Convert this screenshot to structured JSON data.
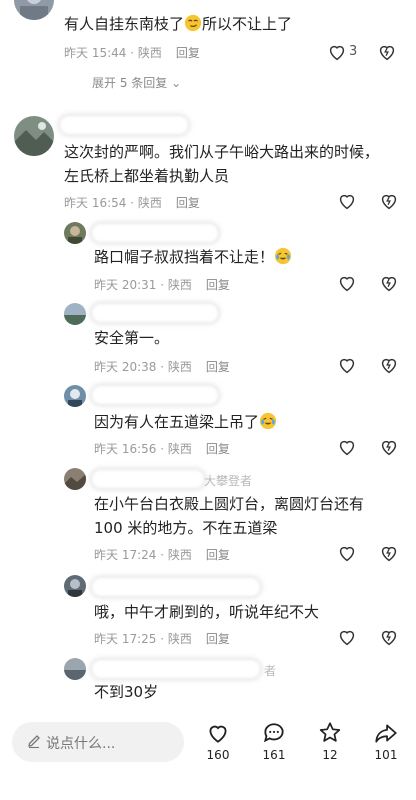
{
  "comments": [
    {
      "text_before": "有人自挂东南枝了",
      "text_after": "所以不让上了",
      "time": "昨天 15:44 · 陕西",
      "reply_label": "回复",
      "likes": "3"
    },
    {
      "expand_label": "展开 5 条回复 ⌄"
    },
    {
      "line1": "这次封的严啊。我们从子午峪大路出来的时候，",
      "line2": "左氏桥上都坐着执勤人员",
      "time": "昨天 16:54 · 陕西",
      "reply_label": "回复"
    },
    {
      "text": "路口帽子叔叔挡着不让走！",
      "time": "昨天 20:31 · 陕西",
      "reply_label": "回复"
    },
    {
      "text": "安全第一。",
      "time": "昨天 20:38 · 陕西",
      "reply_label": "回复"
    },
    {
      "text": "因为有人在五道梁上吊了",
      "time": "昨天 16:56 · 陕西",
      "reply_label": "回复"
    },
    {
      "name_partial": "大攀登者",
      "line1": "在小午台白衣殿上圆灯台，离圆灯台还有",
      "line2": "100 米的地方。不在五道梁",
      "time": "昨天 17:24 · 陕西",
      "reply_label": "回复"
    },
    {
      "text": "哦，中午才刷到的，听说年纪不大",
      "time": "昨天 17:25 · 陕西",
      "reply_label": "回复"
    },
    {
      "name_partial": "者",
      "text": "不到30岁"
    }
  ],
  "bottom_bar": {
    "input_placeholder": "说点什么...",
    "likes": "160",
    "comments": "161",
    "favorites": "12",
    "shares": "101"
  },
  "colors": {
    "text": "#222222",
    "meta": "#9a9a9a",
    "input_bg": "#f1f1f1"
  }
}
